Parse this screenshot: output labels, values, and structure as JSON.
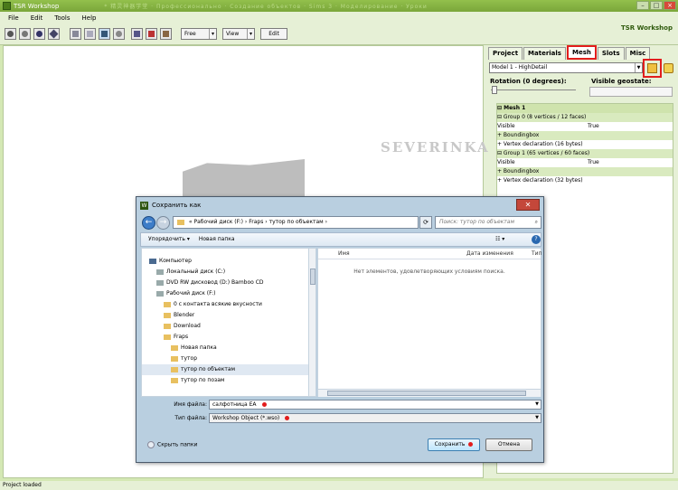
{
  "app": {
    "title": "TSR Workshop",
    "ghost_title": "* 精灵神器学堂 · Профессионально · Создание объектов · Sims 3 · Моделирование · Уроки",
    "logo": "TSR Workshop"
  },
  "menu": [
    "File",
    "Edit",
    "Tools",
    "Help"
  ],
  "toolbar": {
    "free_label": "Free",
    "view_label": "View",
    "edit_label": "Edit"
  },
  "panel": {
    "tabs": [
      "Project",
      "Materials",
      "Mesh",
      "Slots",
      "Misc"
    ],
    "active_tab": "Mesh",
    "model_select": "Model 1 - HighDetail",
    "rotation_label": "Rotation (0 degrees):",
    "geostate_label": "Visible geostate:",
    "tree": [
      {
        "text": "⊟  Mesh 1",
        "style": "bold"
      },
      {
        "text": "   ⊟ Group 0 (8 vertices / 12 faces)",
        "style": "green"
      },
      {
        "text": "       Visible",
        "value": "True",
        "style": ""
      },
      {
        "text": "       + Boundingbox",
        "style": "green"
      },
      {
        "text": "       + Vertex declaration (16 bytes)",
        "style": ""
      },
      {
        "text": "   ⊟ Group 1 (65 vertices / 60 faces)",
        "style": "green"
      },
      {
        "text": "       Visible",
        "value": "True",
        "style": ""
      },
      {
        "text": "       + Boundingbox",
        "style": "green"
      },
      {
        "text": "       + Vertex declaration (32 bytes)",
        "style": ""
      }
    ]
  },
  "watermark": "SEVERINKA",
  "status": "Project loaded",
  "dialog": {
    "title": "Сохранить как",
    "address_parts": [
      "«",
      "Рабочий диск (F:)",
      "›",
      "Fraps",
      "›",
      "тутор по объектам",
      "›"
    ],
    "search_placeholder": "Поиск: тутор по объектам",
    "organize": "Упорядочить ▾",
    "new_folder": "Новая папка",
    "views": "☷ ▾",
    "help": "?",
    "nav_items": [
      {
        "label": "Компьютер",
        "icon": "pc",
        "indent": 8,
        "selected": false
      },
      {
        "label": "Локальный диск (C:)",
        "icon": "drive",
        "indent": 16,
        "selected": false
      },
      {
        "label": "DVD RW дисковод (D:) Bamboo CD",
        "icon": "drive",
        "indent": 16,
        "selected": false
      },
      {
        "label": "Рабочий диск (F:)",
        "icon": "drive",
        "indent": 16,
        "selected": false
      },
      {
        "label": "0 с контакта всякие вкусности",
        "icon": "folder",
        "indent": 24,
        "selected": false
      },
      {
        "label": "Blender",
        "icon": "folder",
        "indent": 24,
        "selected": false
      },
      {
        "label": "Download",
        "icon": "folder",
        "indent": 24,
        "selected": false
      },
      {
        "label": "Fraps",
        "icon": "folder",
        "indent": 24,
        "selected": false
      },
      {
        "label": "Новая папка",
        "icon": "folder",
        "indent": 32,
        "selected": false
      },
      {
        "label": "тутор",
        "icon": "folder",
        "indent": 32,
        "selected": false
      },
      {
        "label": "тутор по объектам",
        "icon": "folder",
        "indent": 32,
        "selected": true
      },
      {
        "label": "тутор по позам",
        "icon": "folder",
        "indent": 32,
        "selected": false
      }
    ],
    "columns": [
      "Имя",
      "Дата изменения",
      "Тип"
    ],
    "empty_message": "Нет элементов, удовлетворяющих условиям поиска.",
    "filename_label": "Имя файла:",
    "filename_value": "салфотница ЕА",
    "filetype_label": "Тип файла:",
    "filetype_value": "Workshop Object (*.wso)",
    "hide_folders": "Скрыть папки",
    "save_button": "Сохранить",
    "cancel_button": "Отмена"
  },
  "colors": {
    "accent_red": "#e21d1d",
    "panel_green": "#e6f0d6"
  }
}
